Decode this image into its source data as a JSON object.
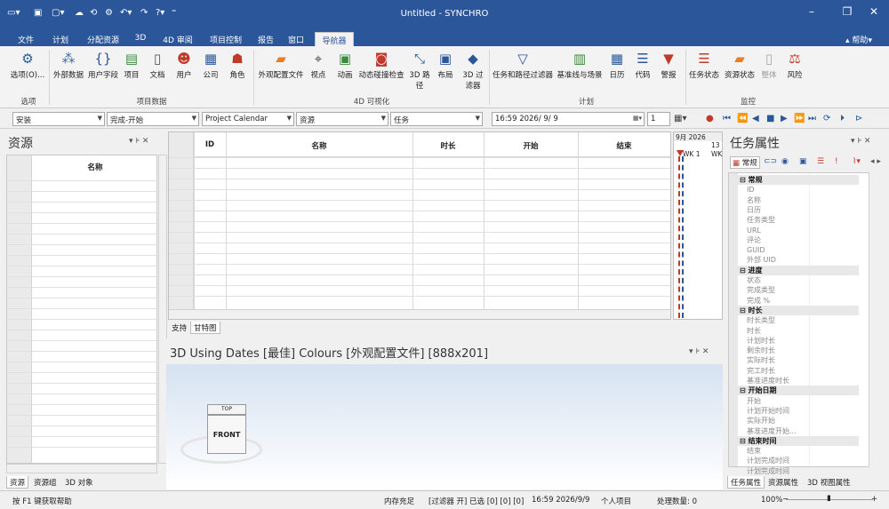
{
  "window": {
    "title": "Untitled - SYNCHRO",
    "help": "帮助"
  },
  "ribbon_tabs": [
    "文件",
    "计划",
    "分配资源",
    "3D",
    "4D 审阅",
    "项目控制",
    "报告",
    "窗口",
    "导航器"
  ],
  "ribbon": {
    "buttons": [
      "选项(O)...",
      "外部数据",
      "用户字段",
      "项目",
      "文档",
      "用户",
      "公司",
      "角色",
      "外观配置文件",
      "视点",
      "动画",
      "动态碰撞检查",
      "3D 路径",
      "布局",
      "3D 过滤器",
      "任务和路径过滤器",
      "基准线与场景",
      "日历",
      "代码",
      "警报",
      "任务状态",
      "资源状态",
      "整体",
      "风险"
    ],
    "groups": [
      "选项",
      "项目数据",
      "4D 可视化",
      "计划",
      "监控"
    ]
  },
  "toolbar": {
    "combo1": "安装",
    "combo2": "完成-开始",
    "combo3": "Project Calendar",
    "combo4": "资源",
    "combo5": "任务",
    "datetime": "16:59 2026/  9/  9",
    "spin": "1"
  },
  "resources": {
    "title": "资源",
    "col_name": "名称",
    "tabs": [
      "资源",
      "资源组",
      "3D 对象"
    ]
  },
  "task_grid": {
    "headers": [
      "ID",
      "名称",
      "时长",
      "开始",
      "结束"
    ],
    "tabs": [
      "支持",
      "甘特图"
    ]
  },
  "gantt": {
    "month": "9月 2026",
    "day": "13",
    "week": "WK 1",
    "week2": "WK"
  },
  "view3d": {
    "title": "3D Using Dates [最佳] Colours [外观配置文件]  [888x201]",
    "cube_top": "TOP",
    "cube_front": "FRONT"
  },
  "task_props": {
    "title": "任务属性",
    "tab_general": "常规",
    "rows": [
      {
        "t": "常规",
        "cat": true
      },
      {
        "t": "ID"
      },
      {
        "t": "名称"
      },
      {
        "t": "日历"
      },
      {
        "t": "任务类型"
      },
      {
        "t": "URL"
      },
      {
        "t": "评论"
      },
      {
        "t": "GUID"
      },
      {
        "t": "外部 UID"
      },
      {
        "t": "进度",
        "cat": true
      },
      {
        "t": "状态"
      },
      {
        "t": "完成类型"
      },
      {
        "t": "完成 %"
      },
      {
        "t": "时长",
        "cat": true
      },
      {
        "t": "时长类型"
      },
      {
        "t": "时长"
      },
      {
        "t": "计划时长"
      },
      {
        "t": "剩余时长"
      },
      {
        "t": "实际时长"
      },
      {
        "t": "完工时长"
      },
      {
        "t": "基准进度时长"
      },
      {
        "t": "开始日期",
        "cat": true
      },
      {
        "t": "开始"
      },
      {
        "t": "计划开始时间"
      },
      {
        "t": "实际开始"
      },
      {
        "t": "基准进度开始..."
      },
      {
        "t": "结束时间",
        "cat": true
      },
      {
        "t": "结束"
      },
      {
        "t": "计划完成时间"
      },
      {
        "t": "计划完成时间"
      }
    ],
    "bottom_tabs": [
      "任务属性",
      "资源属性",
      "3D 视图属性"
    ]
  },
  "status": {
    "help": "按 F1 键获取帮助",
    "memory": "内存充足",
    "filter": "[过滤器 开] 已选 [0] [0] [0]",
    "datetime": "16:59 2026/9/9",
    "project": "个人项目",
    "processing": "处理数量: 0",
    "zoom": "100%"
  }
}
